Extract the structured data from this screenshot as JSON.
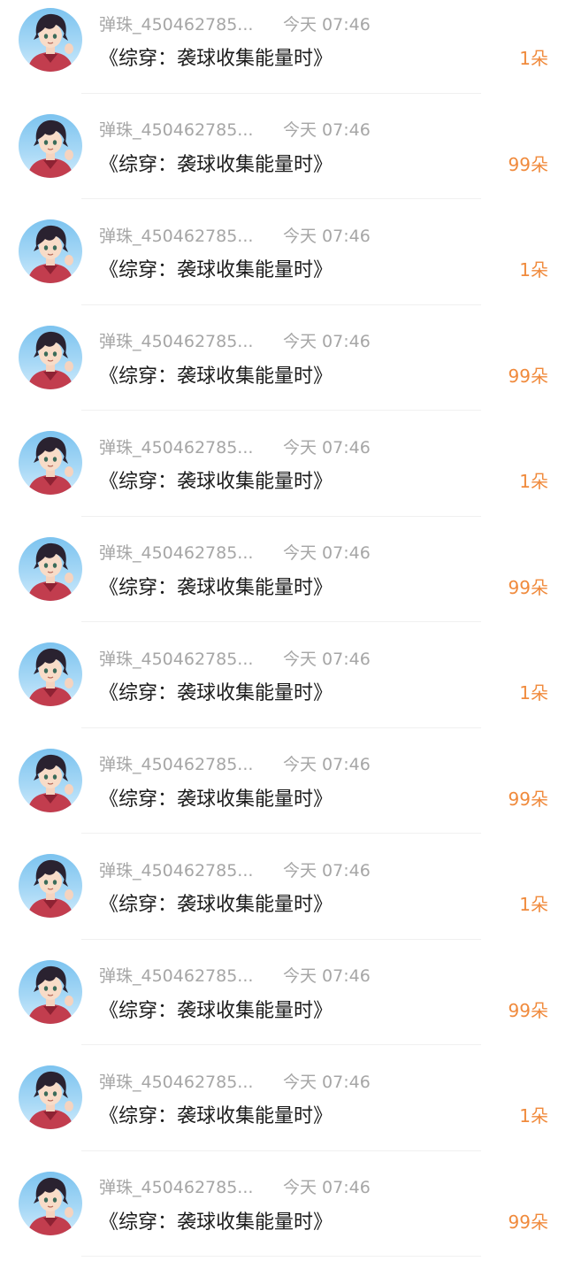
{
  "rows": [
    {
      "user": "弹珠_450462785...",
      "time": "今天 07:46",
      "book": "《综穿：袭球收集能量时》",
      "gift": "1朵"
    },
    {
      "user": "弹珠_450462785...",
      "time": "今天 07:46",
      "book": "《综穿：袭球收集能量时》",
      "gift": "99朵"
    },
    {
      "user": "弹珠_450462785...",
      "time": "今天 07:46",
      "book": "《综穿：袭球收集能量时》",
      "gift": "1朵"
    },
    {
      "user": "弹珠_450462785...",
      "time": "今天 07:46",
      "book": "《综穿：袭球收集能量时》",
      "gift": "99朵"
    },
    {
      "user": "弹珠_450462785...",
      "time": "今天 07:46",
      "book": "《综穿：袭球收集能量时》",
      "gift": "1朵"
    },
    {
      "user": "弹珠_450462785...",
      "time": "今天 07:46",
      "book": "《综穿：袭球收集能量时》",
      "gift": "99朵"
    },
    {
      "user": "弹珠_450462785...",
      "time": "今天 07:46",
      "book": "《综穿：袭球收集能量时》",
      "gift": "1朵"
    },
    {
      "user": "弹珠_450462785...",
      "time": "今天 07:46",
      "book": "《综穿：袭球收集能量时》",
      "gift": "99朵"
    },
    {
      "user": "弹珠_450462785...",
      "time": "今天 07:46",
      "book": "《综穿：袭球收集能量时》",
      "gift": "1朵"
    },
    {
      "user": "弹珠_450462785...",
      "time": "今天 07:46",
      "book": "《综穿：袭球收集能量时》",
      "gift": "99朵"
    },
    {
      "user": "弹珠_450462785...",
      "time": "今天 07:46",
      "book": "《综穿：袭球收集能量时》",
      "gift": "1朵"
    },
    {
      "user": "弹珠_450462785...",
      "time": "今天 07:46",
      "book": "《综穿：袭球收集能量时》",
      "gift": "99朵"
    }
  ],
  "colors": {
    "gift": "#f08a3c",
    "meta": "#a6a6a6",
    "title": "#1b1b1b",
    "avatar_sky": "#7cc3ef",
    "avatar_shirt": "#c23d4e"
  },
  "icons": {
    "avatar": "anime-character-avatar"
  }
}
